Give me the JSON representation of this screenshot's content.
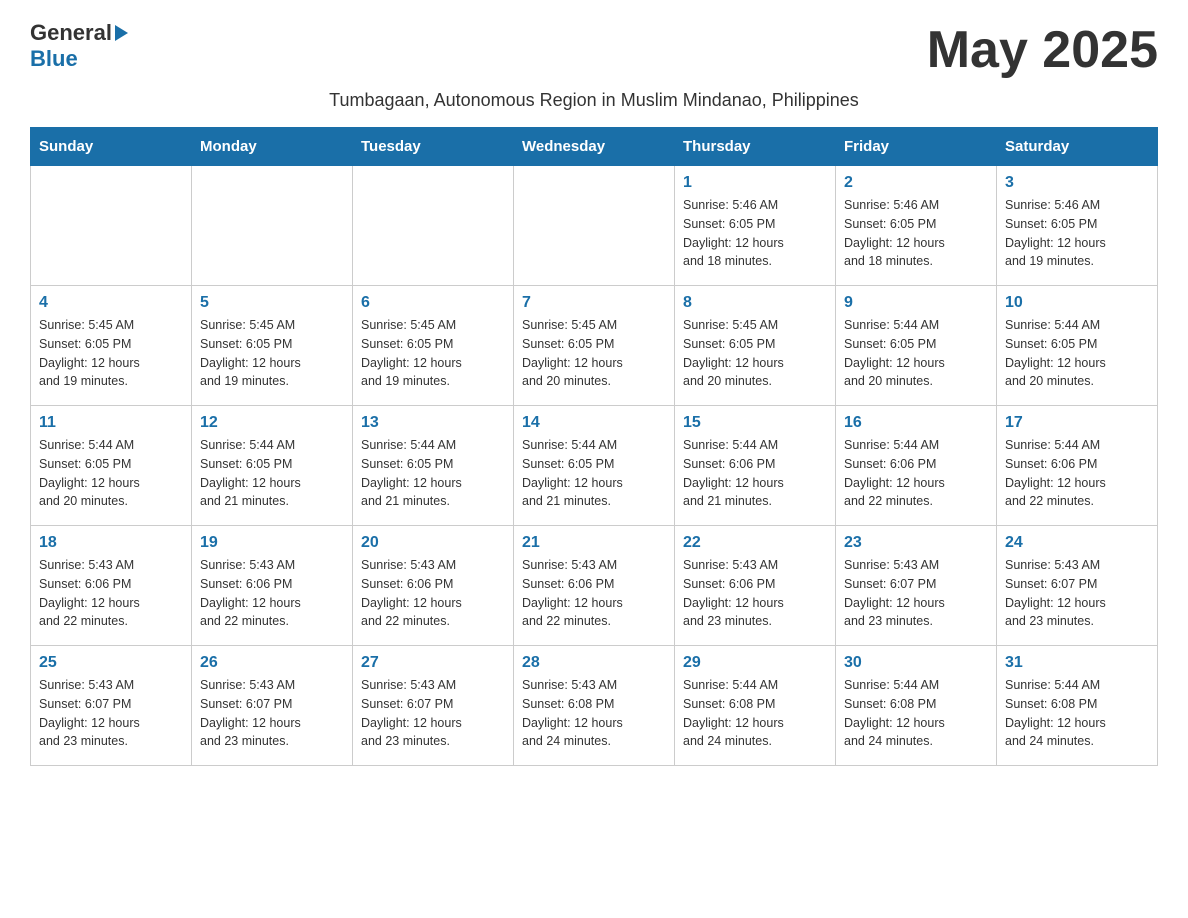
{
  "header": {
    "logo_general": "General",
    "logo_blue": "Blue",
    "month_title": "May 2025",
    "subtitle": "Tumbagaan, Autonomous Region in Muslim Mindanao, Philippines"
  },
  "days_of_week": [
    "Sunday",
    "Monday",
    "Tuesday",
    "Wednesday",
    "Thursday",
    "Friday",
    "Saturday"
  ],
  "weeks": [
    [
      {
        "day": "",
        "info": ""
      },
      {
        "day": "",
        "info": ""
      },
      {
        "day": "",
        "info": ""
      },
      {
        "day": "",
        "info": ""
      },
      {
        "day": "1",
        "info": "Sunrise: 5:46 AM\nSunset: 6:05 PM\nDaylight: 12 hours\nand 18 minutes."
      },
      {
        "day": "2",
        "info": "Sunrise: 5:46 AM\nSunset: 6:05 PM\nDaylight: 12 hours\nand 18 minutes."
      },
      {
        "day": "3",
        "info": "Sunrise: 5:46 AM\nSunset: 6:05 PM\nDaylight: 12 hours\nand 19 minutes."
      }
    ],
    [
      {
        "day": "4",
        "info": "Sunrise: 5:45 AM\nSunset: 6:05 PM\nDaylight: 12 hours\nand 19 minutes."
      },
      {
        "day": "5",
        "info": "Sunrise: 5:45 AM\nSunset: 6:05 PM\nDaylight: 12 hours\nand 19 minutes."
      },
      {
        "day": "6",
        "info": "Sunrise: 5:45 AM\nSunset: 6:05 PM\nDaylight: 12 hours\nand 19 minutes."
      },
      {
        "day": "7",
        "info": "Sunrise: 5:45 AM\nSunset: 6:05 PM\nDaylight: 12 hours\nand 20 minutes."
      },
      {
        "day": "8",
        "info": "Sunrise: 5:45 AM\nSunset: 6:05 PM\nDaylight: 12 hours\nand 20 minutes."
      },
      {
        "day": "9",
        "info": "Sunrise: 5:44 AM\nSunset: 6:05 PM\nDaylight: 12 hours\nand 20 minutes."
      },
      {
        "day": "10",
        "info": "Sunrise: 5:44 AM\nSunset: 6:05 PM\nDaylight: 12 hours\nand 20 minutes."
      }
    ],
    [
      {
        "day": "11",
        "info": "Sunrise: 5:44 AM\nSunset: 6:05 PM\nDaylight: 12 hours\nand 20 minutes."
      },
      {
        "day": "12",
        "info": "Sunrise: 5:44 AM\nSunset: 6:05 PM\nDaylight: 12 hours\nand 21 minutes."
      },
      {
        "day": "13",
        "info": "Sunrise: 5:44 AM\nSunset: 6:05 PM\nDaylight: 12 hours\nand 21 minutes."
      },
      {
        "day": "14",
        "info": "Sunrise: 5:44 AM\nSunset: 6:05 PM\nDaylight: 12 hours\nand 21 minutes."
      },
      {
        "day": "15",
        "info": "Sunrise: 5:44 AM\nSunset: 6:06 PM\nDaylight: 12 hours\nand 21 minutes."
      },
      {
        "day": "16",
        "info": "Sunrise: 5:44 AM\nSunset: 6:06 PM\nDaylight: 12 hours\nand 22 minutes."
      },
      {
        "day": "17",
        "info": "Sunrise: 5:44 AM\nSunset: 6:06 PM\nDaylight: 12 hours\nand 22 minutes."
      }
    ],
    [
      {
        "day": "18",
        "info": "Sunrise: 5:43 AM\nSunset: 6:06 PM\nDaylight: 12 hours\nand 22 minutes."
      },
      {
        "day": "19",
        "info": "Sunrise: 5:43 AM\nSunset: 6:06 PM\nDaylight: 12 hours\nand 22 minutes."
      },
      {
        "day": "20",
        "info": "Sunrise: 5:43 AM\nSunset: 6:06 PM\nDaylight: 12 hours\nand 22 minutes."
      },
      {
        "day": "21",
        "info": "Sunrise: 5:43 AM\nSunset: 6:06 PM\nDaylight: 12 hours\nand 22 minutes."
      },
      {
        "day": "22",
        "info": "Sunrise: 5:43 AM\nSunset: 6:06 PM\nDaylight: 12 hours\nand 23 minutes."
      },
      {
        "day": "23",
        "info": "Sunrise: 5:43 AM\nSunset: 6:07 PM\nDaylight: 12 hours\nand 23 minutes."
      },
      {
        "day": "24",
        "info": "Sunrise: 5:43 AM\nSunset: 6:07 PM\nDaylight: 12 hours\nand 23 minutes."
      }
    ],
    [
      {
        "day": "25",
        "info": "Sunrise: 5:43 AM\nSunset: 6:07 PM\nDaylight: 12 hours\nand 23 minutes."
      },
      {
        "day": "26",
        "info": "Sunrise: 5:43 AM\nSunset: 6:07 PM\nDaylight: 12 hours\nand 23 minutes."
      },
      {
        "day": "27",
        "info": "Sunrise: 5:43 AM\nSunset: 6:07 PM\nDaylight: 12 hours\nand 23 minutes."
      },
      {
        "day": "28",
        "info": "Sunrise: 5:43 AM\nSunset: 6:08 PM\nDaylight: 12 hours\nand 24 minutes."
      },
      {
        "day": "29",
        "info": "Sunrise: 5:44 AM\nSunset: 6:08 PM\nDaylight: 12 hours\nand 24 minutes."
      },
      {
        "day": "30",
        "info": "Sunrise: 5:44 AM\nSunset: 6:08 PM\nDaylight: 12 hours\nand 24 minutes."
      },
      {
        "day": "31",
        "info": "Sunrise: 5:44 AM\nSunset: 6:08 PM\nDaylight: 12 hours\nand 24 minutes."
      }
    ]
  ]
}
